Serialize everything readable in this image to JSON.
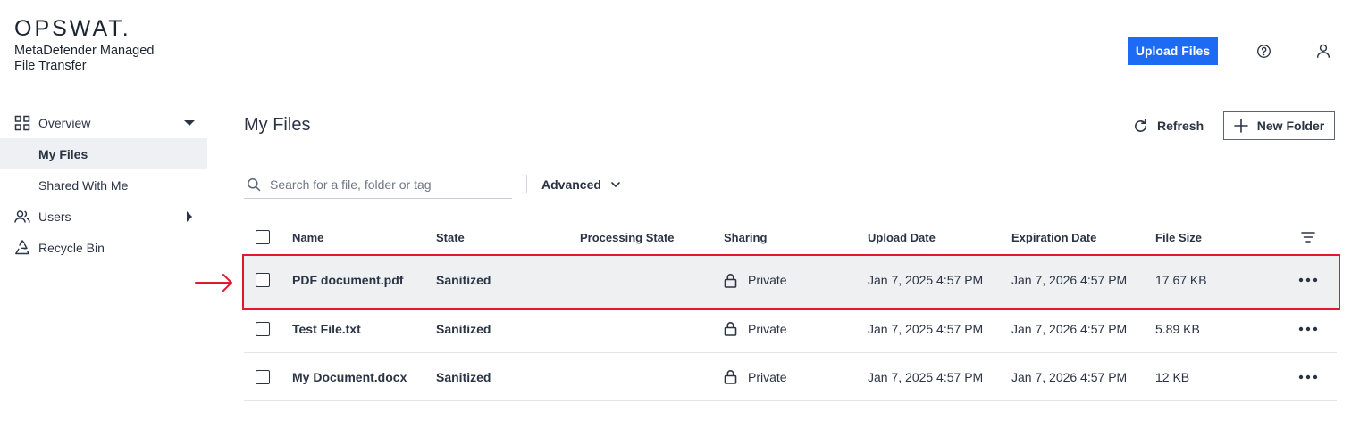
{
  "brand": {
    "logo_text": "OPSWAT.",
    "product_line1": "MetaDefender Managed",
    "product_line2": "File Transfer"
  },
  "header": {
    "upload_label": "Upload Files",
    "help_icon": "question-circle-icon",
    "user_icon": "user-icon"
  },
  "sidebar": {
    "items": [
      {
        "label": "Overview",
        "icon": "grid-icon",
        "caret": "caret-down-icon"
      },
      {
        "label": "My Files"
      },
      {
        "label": "Shared With Me"
      },
      {
        "label": "Users",
        "icon": "users-icon",
        "caret": "caret-right-icon"
      },
      {
        "label": "Recycle Bin",
        "icon": "recycle-icon"
      }
    ]
  },
  "main": {
    "title": "My Files",
    "refresh_label": "Refresh",
    "new_folder_label": "New Folder",
    "search_placeholder": "Search for a file, folder or tag",
    "advanced_label": "Advanced"
  },
  "table": {
    "columns": [
      "Name",
      "State",
      "Processing State",
      "Sharing",
      "Upload Date",
      "Expiration Date",
      "File Size"
    ],
    "rows": [
      {
        "name": "PDF document.pdf",
        "state": "Sanitized",
        "processing": "",
        "sharing": "Private",
        "upload": "Jan 7, 2025 4:57 PM",
        "expiration": "Jan 7, 2026 4:57 PM",
        "size": "17.67 KB"
      },
      {
        "name": "Test File.txt",
        "state": "Sanitized",
        "processing": "",
        "sharing": "Private",
        "upload": "Jan 7, 2025 4:57 PM",
        "expiration": "Jan 7, 2026 4:57 PM",
        "size": "5.89 KB"
      },
      {
        "name": "My Document.docx",
        "state": "Sanitized",
        "processing": "",
        "sharing": "Private",
        "upload": "Jan 7, 2025 4:57 PM",
        "expiration": "Jan 7, 2026 4:57 PM",
        "size": "12 KB"
      }
    ]
  },
  "colors": {
    "accent": "#1d6bf3",
    "highlight_border": "#e0192e",
    "text": "#2b3445"
  }
}
